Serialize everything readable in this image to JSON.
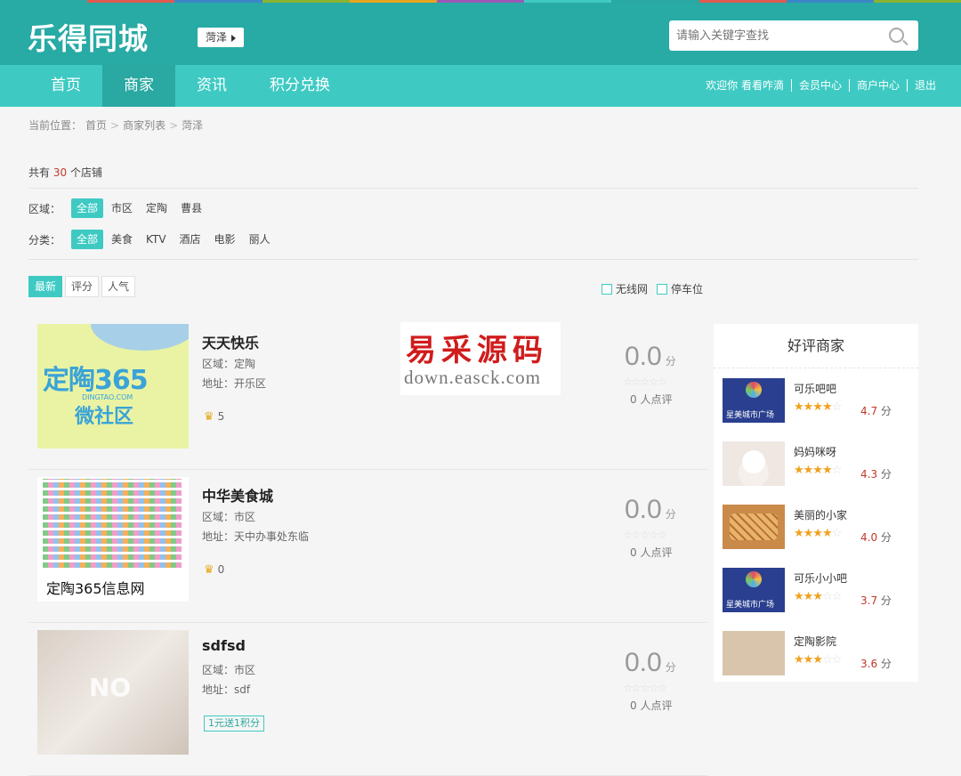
{
  "stripe_colors": [
    "#28aaa5",
    "#e15a4f",
    "#3a86c8",
    "#8bb433",
    "#e8a421",
    "#9b59b6",
    "#3ecac3",
    "#2aa8a2",
    "#e15a4f",
    "#3a86c8",
    "#8bb433"
  ],
  "brand": {
    "logo": "乐得同城",
    "city": "菏泽"
  },
  "search": {
    "placeholder": "请输入关键字查找"
  },
  "nav": {
    "items": [
      {
        "label": "首页"
      },
      {
        "label": "商家"
      },
      {
        "label": "资讯"
      },
      {
        "label": "积分兑换"
      }
    ],
    "active": 1,
    "user_links": [
      {
        "label": "欢迎你 看看咋滴"
      },
      {
        "label": "会员中心"
      },
      {
        "label": "商户中心"
      },
      {
        "label": "退出"
      }
    ]
  },
  "breadcrumb": {
    "prefix": "当前位置：",
    "items": [
      "首页",
      "商家列表",
      "菏泽"
    ],
    "sep": ">"
  },
  "summary": {
    "pre": "共有",
    "count": "30",
    "post": "个店铺"
  },
  "filters": {
    "area": {
      "label": "区域：",
      "options": [
        "全部",
        "市区",
        "定陶",
        "曹县"
      ],
      "active": 0
    },
    "category": {
      "label": "分类：",
      "options": [
        "全部",
        "美食",
        "KTV",
        "酒店",
        "电影",
        "丽人"
      ],
      "active": 0
    }
  },
  "sort": {
    "options": [
      "最新",
      "评分",
      "人气"
    ],
    "active": 0
  },
  "checks": [
    "无线网",
    "停车位"
  ],
  "shops": [
    {
      "name": "天天快乐",
      "area": "区域：定陶",
      "addr": "地址：开乐区",
      "fav": "5",
      "score": "0.0",
      "unit": "分",
      "reviews": "0 人点评",
      "thumb": {
        "big": "定陶365",
        "sub": "DINGTAO.COM",
        "line": "微社区"
      }
    },
    {
      "name": "中华美食城",
      "area": "区域：市区",
      "addr": "地址：天中办事处东临",
      "fav": "0",
      "score": "0.0",
      "unit": "分",
      "reviews": "0 人点评",
      "thumb": {
        "caption": "定陶365信息网"
      }
    },
    {
      "name": "sdfsd",
      "area": "区域：市区",
      "addr": "地址：sdf",
      "tag": "1元送1积分",
      "score": "0.0",
      "unit": "分",
      "reviews": "0 人点评",
      "thumb": {
        "big": "NO"
      }
    }
  ],
  "sidebar": {
    "title": "好评商家",
    "items": [
      {
        "name": "可乐吧吧",
        "rating": 4.7,
        "score": "4.7",
        "unit": "分",
        "thumb_text": "星美城市广场"
      },
      {
        "name": "妈妈咪呀",
        "rating": 4.3,
        "score": "4.3",
        "unit": "分"
      },
      {
        "name": "美丽的小家",
        "rating": 4.0,
        "score": "4.0",
        "unit": "分"
      },
      {
        "name": "可乐小小吧",
        "rating": 3.7,
        "score": "3.7",
        "unit": "分",
        "thumb_text": "星美城市广场"
      },
      {
        "name": "定陶影院",
        "rating": 3.6,
        "score": "3.6",
        "unit": "分"
      }
    ]
  },
  "watermark": {
    "cn": "易采源码",
    "url": "down.easck.com"
  }
}
